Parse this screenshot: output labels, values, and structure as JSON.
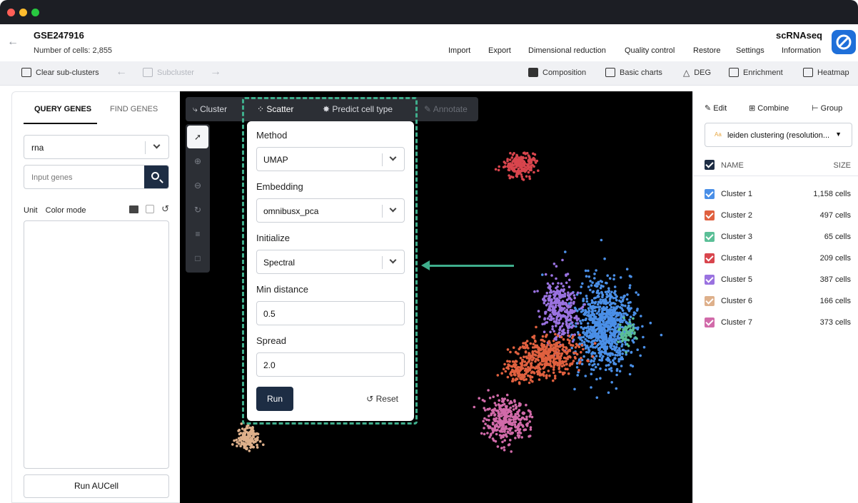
{
  "header": {
    "dataset_title": "GSE247916",
    "cell_count": "Number of cells: 2,855",
    "app_name": "scRNAseq",
    "menu": [
      "Import",
      "Export",
      "Dimensional reduction",
      "Quality control",
      "Restore",
      "Settings",
      "Information"
    ]
  },
  "toolbar": {
    "clear_subclusters": "Clear sub-clusters",
    "subcluster": "Subcluster",
    "composition": "Composition",
    "basic_charts": "Basic charts",
    "deg": "DEG",
    "enrichment": "Enrichment",
    "heatmap": "Heatmap"
  },
  "left_panel": {
    "tabs": [
      "QUERY GENES",
      "FIND GENES"
    ],
    "assay_value": "rna",
    "gene_input_placeholder": "Input genes",
    "unit_label": "Unit",
    "color_mode_label": "Color mode",
    "run_aucell": "Run AUCell"
  },
  "plot_toolbar": {
    "cluster": "Cluster",
    "scatter": "Scatter",
    "predict": "Predict cell type",
    "annotate": "Annotate"
  },
  "scatter_settings": {
    "method_label": "Method",
    "method_value": "UMAP",
    "embedding_label": "Embedding",
    "embedding_value": "omnibusx_pca",
    "initialize_label": "Initialize",
    "initialize_value": "Spectral",
    "min_distance_label": "Min distance",
    "min_distance_value": "0.5",
    "spread_label": "Spread",
    "spread_value": "2.0",
    "run_label": "Run",
    "reset_label": "Reset"
  },
  "right_panel": {
    "edit": "Edit",
    "combine": "Combine",
    "group": "Group",
    "clustering_select": "leiden clustering (resolution...",
    "col_name": "NAME",
    "col_size": "SIZE",
    "clusters": [
      {
        "name": "Cluster 1",
        "size": "1,158 cells",
        "color": "#4a8fe7"
      },
      {
        "name": "Cluster 2",
        "size": "497 cells",
        "color": "#e0603f"
      },
      {
        "name": "Cluster 3",
        "size": "65 cells",
        "color": "#5bbf97"
      },
      {
        "name": "Cluster 4",
        "size": "209 cells",
        "color": "#d8454d"
      },
      {
        "name": "Cluster 5",
        "size": "387 cells",
        "color": "#9a72e0"
      },
      {
        "name": "Cluster 6",
        "size": "166 cells",
        "color": "#deb08b"
      },
      {
        "name": "Cluster 7",
        "size": "373 cells",
        "color": "#d16aa9"
      }
    ]
  },
  "colors": {
    "primary_dark": "#1d2d44",
    "annotation_green": "#3fae8c",
    "plot_background": "#000000"
  }
}
